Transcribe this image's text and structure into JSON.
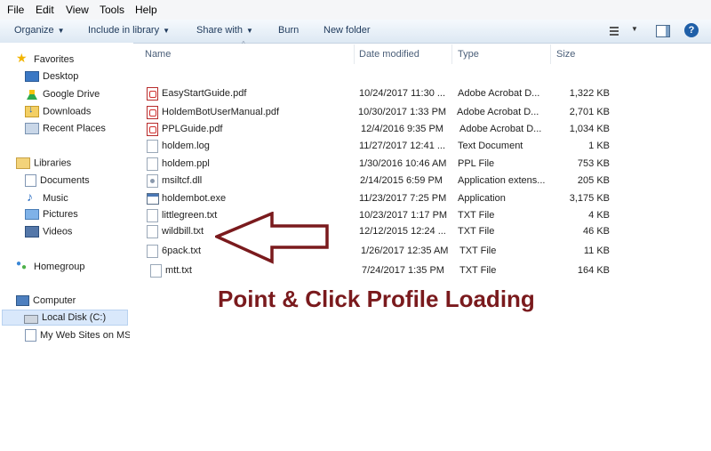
{
  "menu": [
    "File",
    "Edit",
    "View",
    "Tools",
    "Help"
  ],
  "toolbar": {
    "organize": "Organize",
    "include": "Include in library",
    "share": "Share with",
    "burn": "Burn",
    "new_folder": "New folder"
  },
  "nav": {
    "favorites": "Favorites",
    "desktop": "Desktop",
    "google_drive": "Google Drive",
    "downloads": "Downloads",
    "recent": "Recent Places",
    "libraries": "Libraries",
    "documents": "Documents",
    "music": "Music",
    "pictures": "Pictures",
    "videos": "Videos",
    "homegroup": "Homegroup",
    "computer": "Computer",
    "local_disk": "Local Disk (C:)",
    "web_sites": "My Web Sites on MS"
  },
  "columns": {
    "name": "Name",
    "date": "Date modified",
    "type": "Type",
    "size": "Size"
  },
  "files": [
    {
      "name": "EasyStartGuide.pdf",
      "date": "10/24/2017 11:30 ...",
      "type": "Adobe Acrobat D...",
      "size": "1,322 KB"
    },
    {
      "name": "HoldemBotUserManual.pdf",
      "date": "10/30/2017 1:33 PM",
      "type": "Adobe Acrobat D...",
      "size": "2,701 KB"
    },
    {
      "name": "PPLGuide.pdf",
      "date": "12/4/2016 9:35 PM",
      "type": "Adobe Acrobat D...",
      "size": "1,034 KB"
    },
    {
      "name": "holdem.log",
      "date": "11/27/2017 12:41 ...",
      "type": "Text Document",
      "size": "1 KB"
    },
    {
      "name": "holdem.ppl",
      "date": "1/30/2016 10:46 AM",
      "type": "PPL File",
      "size": "753 KB"
    },
    {
      "name": "msiltcf.dll",
      "date": "2/14/2015 6:59 PM",
      "type": "Application extens...",
      "size": "205 KB"
    },
    {
      "name": "holdembot.exe",
      "date": "11/23/2017 7:25 PM",
      "type": "Application",
      "size": "3,175 KB"
    },
    {
      "name": "littlegreen.txt",
      "date": "10/23/2017 1:17 PM",
      "type": "TXT File",
      "size": "4 KB"
    },
    {
      "name": "wildbill.txt",
      "date": "12/12/2015 12:24 ...",
      "type": "TXT File",
      "size": "46 KB"
    },
    {
      "name": "6pack.txt",
      "date": "1/26/2017 12:35 AM",
      "type": "TXT File",
      "size": "11 KB"
    },
    {
      "name": "mtt.txt",
      "date": "7/24/2017 1:35 PM",
      "type": "TXT File",
      "size": "164 KB"
    }
  ],
  "caption": "Point & Click Profile Loading",
  "colors": {
    "caption": "#7a1a1d",
    "arrow": "#7a1a1d"
  }
}
